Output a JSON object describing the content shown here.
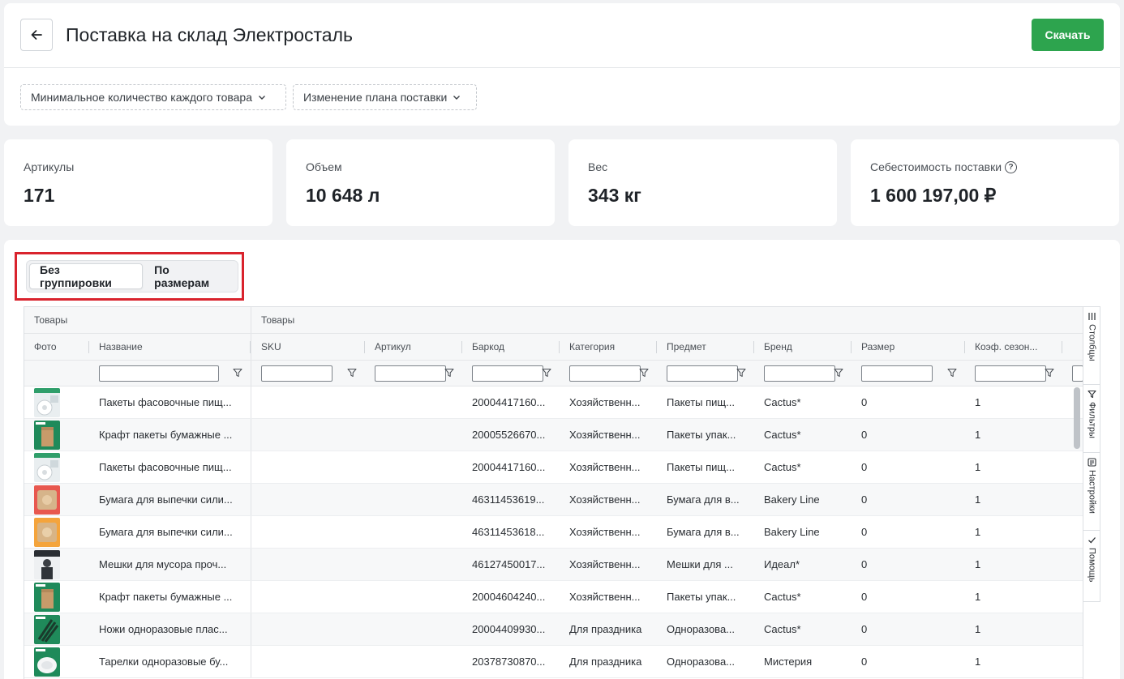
{
  "header": {
    "title": "Поставка на склад Электросталь",
    "download_label": "Скачать",
    "dropdowns": [
      "Минимальное количество каждого товара",
      "Изменение плана поставки"
    ]
  },
  "metrics": [
    {
      "label": "Артикулы",
      "value": "171"
    },
    {
      "label": "Объем",
      "value": "10 648 л"
    },
    {
      "label": "Вес",
      "value": "343 кг"
    },
    {
      "label": "Себестоимость поставки",
      "value": "1 600 197,00 ₽"
    }
  ],
  "grouping": {
    "options": [
      "Без группировки",
      "По размерам"
    ],
    "selected": "Без группировки"
  },
  "table": {
    "groups": [
      "Товары",
      "Товары"
    ],
    "columns": [
      "Фото",
      "Название",
      "SKU",
      "Артикул",
      "Баркод",
      "Категория",
      "Предмет",
      "Бренд",
      "Размер",
      "Коэф. сезон..."
    ],
    "rows": [
      {
        "name": "Пакеты фасовочные пищ...",
        "sku": "",
        "article": "",
        "barcode": "20004417160...",
        "category": "Хозяйственн...",
        "subject": "Пакеты пищ...",
        "brand": "Cactus*",
        "size": "0",
        "coef": "1",
        "thumb": "film-roll"
      },
      {
        "name": "Крафт пакеты бумажные ...",
        "sku": "",
        "article": "",
        "barcode": "20005526670...",
        "category": "Хозяйственн...",
        "subject": "Пакеты упак...",
        "brand": "Cactus*",
        "size": "0",
        "coef": "1",
        "thumb": "kraft-bag"
      },
      {
        "name": "Пакеты фасовочные пищ...",
        "sku": "",
        "article": "",
        "barcode": "20004417160...",
        "category": "Хозяйственн...",
        "subject": "Пакеты пищ...",
        "brand": "Cactus*",
        "size": "0",
        "coef": "1",
        "thumb": "film-roll"
      },
      {
        "name": "Бумага для выпечки сили...",
        "sku": "",
        "article": "",
        "barcode": "46311453619...",
        "category": "Хозяйственн...",
        "subject": "Бумага для в...",
        "brand": "Bakery Line",
        "size": "0",
        "coef": "1",
        "thumb": "baking-paper-pink"
      },
      {
        "name": "Бумага для выпечки сили...",
        "sku": "",
        "article": "",
        "barcode": "46311453618...",
        "category": "Хозяйственн...",
        "subject": "Бумага для в...",
        "brand": "Bakery Line",
        "size": "0",
        "coef": "1",
        "thumb": "baking-paper-tan"
      },
      {
        "name": "Мешки для мусора проч...",
        "sku": "",
        "article": "",
        "barcode": "46127450017...",
        "category": "Хозяйственн...",
        "subject": "Мешки для ...",
        "brand": "Идеал*",
        "size": "0",
        "coef": "1",
        "thumb": "garbage-bags"
      },
      {
        "name": "Крафт пакеты бумажные ...",
        "sku": "",
        "article": "",
        "barcode": "20004604240...",
        "category": "Хозяйственн...",
        "subject": "Пакеты упак...",
        "brand": "Cactus*",
        "size": "0",
        "coef": "1",
        "thumb": "kraft-bag"
      },
      {
        "name": "Ножи одноразовые плас...",
        "sku": "",
        "article": "",
        "barcode": "20004409930...",
        "category": "Для праздника",
        "subject": "Одноразова...",
        "brand": "Cactus*",
        "size": "0",
        "coef": "1",
        "thumb": "knives"
      },
      {
        "name": "Тарелки одноразовые бу...",
        "sku": "",
        "article": "",
        "barcode": "20378730870...",
        "category": "Для праздника",
        "subject": "Одноразова...",
        "brand": "Мистерия",
        "size": "0",
        "coef": "1",
        "thumb": "plates"
      }
    ]
  },
  "side_panel": {
    "tabs": [
      "Столбцы",
      "Фильтры",
      "Настройки",
      "Помощь"
    ]
  },
  "colors": {
    "accent_green": "#2da44e",
    "link_blue": "#1f6bb8",
    "highlight_red": "#d9232d"
  }
}
